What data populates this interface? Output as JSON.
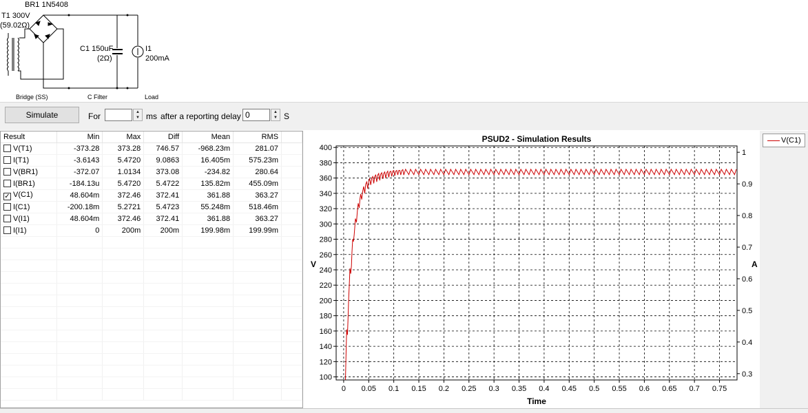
{
  "schematic": {
    "bridge_label": "BR1 1N5408",
    "transformer_label": "T1 300V",
    "transformer_resistance": "(59.02Ω)",
    "capacitor_label": "C1 150uF",
    "capacitor_resistance": "(2Ω)",
    "load_label": "I1",
    "load_value": "200mA",
    "section_bridge": "Bridge (SS)",
    "section_filter": "C Filter",
    "section_load": "Load"
  },
  "toolbar": {
    "simulate_label": "Simulate",
    "for_label": "For",
    "duration_value": "",
    "ms_label": "ms",
    "delay_label": "after a reporting delay of",
    "delay_value": "0",
    "s_label": "S"
  },
  "table": {
    "columns": [
      "Result",
      "Min",
      "Max",
      "Diff",
      "Mean",
      "RMS"
    ],
    "rows": [
      {
        "name": "V(T1)",
        "checked": false,
        "min": "-373.28",
        "max": "373.28",
        "diff": "746.57",
        "mean": "-968.23m",
        "rms": "281.07"
      },
      {
        "name": "I(T1)",
        "checked": false,
        "min": "-3.6143",
        "max": "5.4720",
        "diff": "9.0863",
        "mean": "16.405m",
        "rms": "575.23m"
      },
      {
        "name": "V(BR1)",
        "checked": false,
        "min": "-372.07",
        "max": "1.0134",
        "diff": "373.08",
        "mean": "-234.82",
        "rms": "280.64"
      },
      {
        "name": "I(BR1)",
        "checked": false,
        "min": "-184.13u",
        "max": "5.4720",
        "diff": "5.4722",
        "mean": "135.82m",
        "rms": "455.09m"
      },
      {
        "name": "V(C1)",
        "checked": true,
        "min": "48.604m",
        "max": "372.46",
        "diff": "372.41",
        "mean": "361.88",
        "rms": "363.27"
      },
      {
        "name": "I(C1)",
        "checked": false,
        "min": "-200.18m",
        "max": "5.2721",
        "diff": "5.4723",
        "mean": "55.248m",
        "rms": "518.46m"
      },
      {
        "name": "V(I1)",
        "checked": false,
        "min": "48.604m",
        "max": "372.46",
        "diff": "372.41",
        "mean": "361.88",
        "rms": "363.27"
      },
      {
        "name": "I(I1)",
        "checked": false,
        "min": "0",
        "max": "200m",
        "diff": "200m",
        "mean": "199.98m",
        "rms": "199.99m"
      }
    ]
  },
  "legend": {
    "entry": "V(C1)",
    "color": "#cc0000"
  },
  "chart_data": {
    "type": "line",
    "title": "PSUD2 - Simulation Results",
    "xlabel": "Time",
    "ylabel": "V",
    "y2label": "A",
    "xlim": [
      -0.015,
      0.785
    ],
    "ylim": [
      96,
      402
    ],
    "y2lim": [
      0.28,
      1.02
    ],
    "xticks": [
      "0",
      "0.05",
      "0.1",
      "0.15",
      "0.2",
      "0.25",
      "0.3",
      "0.35",
      "0.4",
      "0.45",
      "0.5",
      "0.55",
      "0.6",
      "0.65",
      "0.7",
      "0.75"
    ],
    "xtick_values": [
      0,
      0.05,
      0.1,
      0.15,
      0.2,
      0.25,
      0.3,
      0.35,
      0.4,
      0.45,
      0.5,
      0.55,
      0.6,
      0.65,
      0.7,
      0.75
    ],
    "yticks": [
      100,
      120,
      140,
      160,
      180,
      200,
      220,
      240,
      260,
      280,
      300,
      320,
      340,
      360,
      380,
      400
    ],
    "y2ticks": [
      "0.3",
      "0.4",
      "0.5",
      "0.6",
      "0.7",
      "0.8",
      "0.9",
      "1"
    ],
    "y2tick_values": [
      0.3,
      0.4,
      0.5,
      0.6,
      0.7,
      0.8,
      0.9,
      1.0
    ],
    "grid": true,
    "series": [
      {
        "name": "V(C1)",
        "color": "#cc0000",
        "points": [
          [
            0.0035,
            96
          ],
          [
            0.005,
            135
          ],
          [
            0.006,
            162
          ],
          [
            0.0075,
            155
          ],
          [
            0.0085,
            172
          ],
          [
            0.01,
            203
          ],
          [
            0.0115,
            225
          ],
          [
            0.0125,
            242
          ],
          [
            0.014,
            235
          ],
          [
            0.0155,
            245
          ],
          [
            0.0165,
            262
          ],
          [
            0.018,
            280
          ],
          [
            0.0195,
            277
          ],
          [
            0.021,
            286
          ],
          [
            0.022,
            294
          ],
          [
            0.0235,
            307
          ],
          [
            0.0255,
            302
          ],
          [
            0.0275,
            318
          ],
          [
            0.029,
            327
          ],
          [
            0.031,
            321
          ],
          [
            0.0325,
            333
          ],
          [
            0.034,
            339
          ],
          [
            0.036,
            332
          ],
          [
            0.038,
            343
          ],
          [
            0.04,
            349
          ],
          [
            0.042,
            340
          ],
          [
            0.044,
            352
          ],
          [
            0.046,
            355
          ],
          [
            0.048,
            346
          ],
          [
            0.05,
            356
          ],
          [
            0.052,
            359
          ],
          [
            0.054,
            351
          ],
          [
            0.056,
            360
          ],
          [
            0.058,
            362
          ],
          [
            0.06,
            353
          ],
          [
            0.062,
            362
          ],
          [
            0.064,
            364
          ],
          [
            0.066,
            355
          ],
          [
            0.068,
            364
          ],
          [
            0.07,
            366
          ],
          [
            0.072,
            357
          ],
          [
            0.074,
            365
          ],
          [
            0.076,
            367
          ],
          [
            0.078,
            359
          ],
          [
            0.08,
            366
          ],
          [
            0.082,
            368
          ],
          [
            0.084,
            360
          ],
          [
            0.086,
            367
          ],
          [
            0.088,
            369
          ],
          [
            0.09,
            361
          ],
          [
            0.092,
            368
          ],
          [
            0.094,
            369
          ],
          [
            0.096,
            362
          ],
          [
            0.098,
            369
          ],
          [
            0.1,
            370
          ],
          [
            0.102,
            363
          ],
          [
            0.104,
            369
          ],
          [
            0.106,
            370
          ],
          [
            0.108,
            364
          ],
          [
            0.11,
            370
          ],
          [
            0.112,
            370
          ],
          [
            0.114,
            364
          ],
          [
            0.116,
            370
          ],
          [
            0.118,
            371
          ],
          [
            0.12,
            364
          ]
        ],
        "steady_ripple": {
          "from": 0.12,
          "to": 0.78,
          "period": 0.01,
          "high": 371.5,
          "low": 364.5
        }
      }
    ]
  }
}
